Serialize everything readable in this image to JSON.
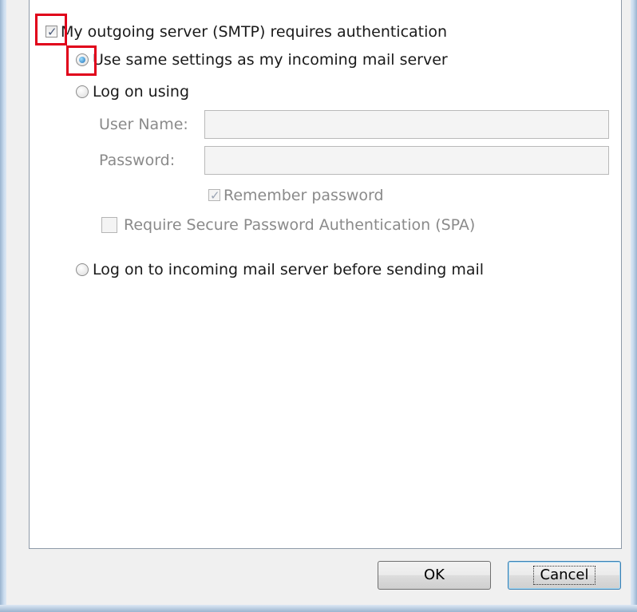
{
  "smtp_auth": {
    "checkbox_label": "My outgoing server (SMTP) requires authentication",
    "checked": true
  },
  "options": {
    "use_same_settings": "Use same settings as my incoming mail server",
    "log_on_using": "Log on using",
    "log_on_incoming_first": "Log on to incoming mail server before sending mail",
    "selected": "use_same_settings"
  },
  "credentials": {
    "user_name_label": "User Name:",
    "password_label": "Password:",
    "user_name_value": "",
    "password_value": "",
    "remember_password": "Remember password",
    "remember_checked": true,
    "require_spa": "Require Secure Password Authentication (SPA)",
    "spa_checked": false
  },
  "buttons": {
    "ok": "OK",
    "cancel": "Cancel"
  },
  "colors": {
    "highlight": "#e0001a",
    "disabled_text": "#8a8a8a"
  }
}
